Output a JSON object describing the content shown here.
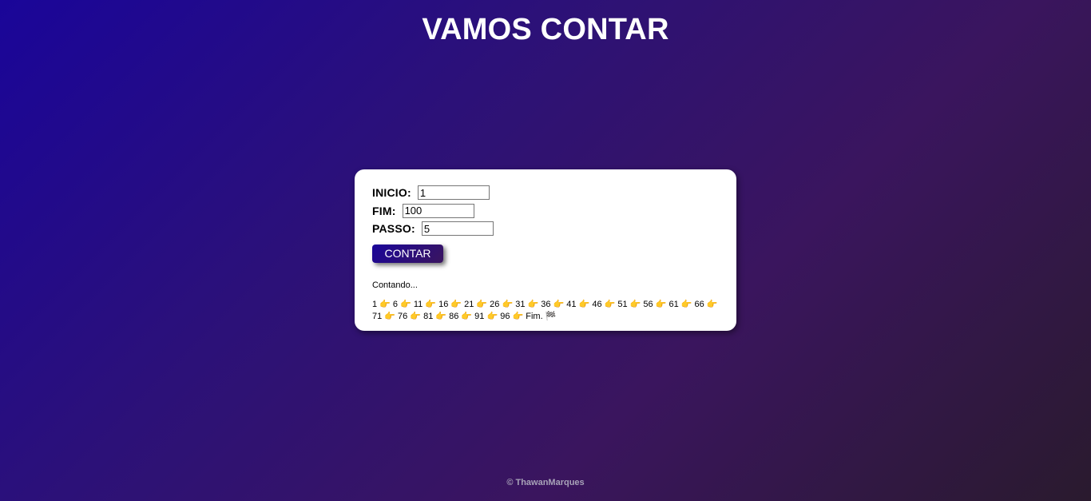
{
  "title": "VAMOS CONTAR",
  "form": {
    "inicio_label": "INICIO:",
    "inicio_value": "1",
    "fim_label": "FIM:",
    "fim_value": "100",
    "passo_label": "PASSO:",
    "passo_value": "5",
    "button_label": "CONTAR"
  },
  "output": {
    "status": "Contando...",
    "result": "1 👉 6 👉 11 👉 16 👉 21 👉 26 👉 31 👉 36 👉 41 👉 46 👉 51 👉 56 👉 61 👉 66 👉 71 👉 76 👉 81 👉 86 👉 91 👉 96 👉 Fim. 🏁"
  },
  "footer": "© ThawanMarques",
  "colors": {
    "gradient_start": "#1a0599",
    "gradient_end": "#2a1a2e",
    "card_bg": "#ffffff",
    "button_bg": "#2a0d7a"
  },
  "icons": {
    "step_separator": "pointing-right-hand-icon",
    "finish": "checkered-flag-icon"
  }
}
